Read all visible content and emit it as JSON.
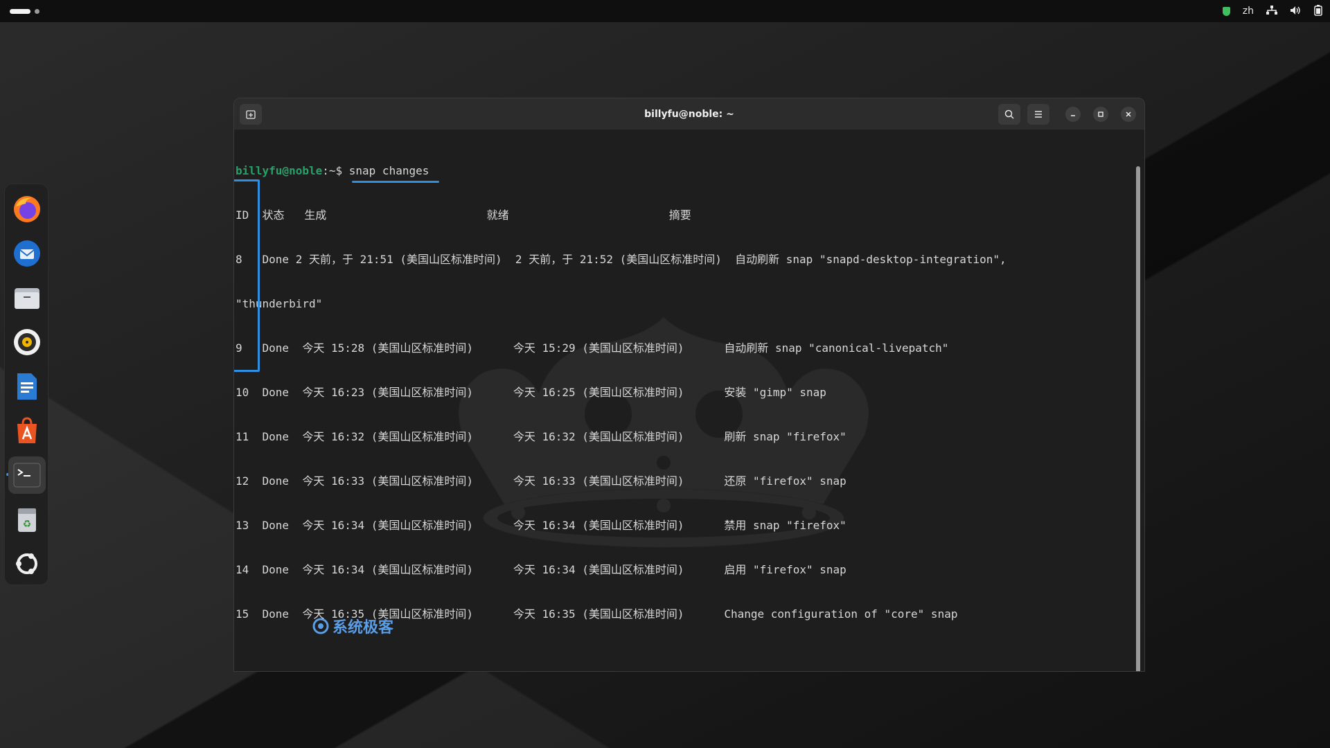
{
  "topbar": {
    "input_method": "zh",
    "icons": [
      "security-shield-icon",
      "network-icon",
      "volume-icon",
      "battery-icon"
    ]
  },
  "dock": {
    "items": [
      {
        "name": "firefox",
        "icon": "firefox-icon"
      },
      {
        "name": "thunderbird",
        "icon": "thunderbird-icon"
      },
      {
        "name": "files",
        "icon": "files-icon"
      },
      {
        "name": "rhythmbox",
        "icon": "rhythmbox-icon"
      },
      {
        "name": "libreoffice-writer",
        "icon": "writer-icon"
      },
      {
        "name": "app-center",
        "icon": "app-center-icon"
      },
      {
        "name": "terminal",
        "icon": "terminal-icon",
        "active": true
      },
      {
        "name": "trash",
        "icon": "trash-icon"
      },
      {
        "name": "show-apps",
        "icon": "ubuntu-icon"
      }
    ]
  },
  "window": {
    "title": "billyfu@noble: ~"
  },
  "terminal": {
    "prompt_user": "billyfu@noble",
    "prompt_rest": ":~$ ",
    "command": "snap changes",
    "header": "ID  状态   生成                        就绪                        摘要",
    "rows": [
      "8   Done 2 天前，于 21:51 (美国山区标准时间)  2 天前，于 21:52 (美国山区标准时间)  自动刷新 snap \"snapd-desktop-integration\",",
      "\"thunderbird\"",
      "9   Done  今天 15:28 (美国山区标准时间)      今天 15:29 (美国山区标准时间)      自动刷新 snap \"canonical-livepatch\"",
      "10  Done  今天 16:23 (美国山区标准时间)      今天 16:25 (美国山区标准时间)      安装 \"gimp\" snap",
      "11  Done  今天 16:32 (美国山区标准时间)      今天 16:32 (美国山区标准时间)      刷新 snap \"firefox\"",
      "12  Done  今天 16:33 (美国山区标准时间)      今天 16:33 (美国山区标准时间)      还原 \"firefox\" snap",
      "13  Done  今天 16:34 (美国山区标准时间)      今天 16:34 (美国山区标准时间)      禁用 snap \"firefox\"",
      "14  Done  今天 16:34 (美国山区标准时间)      今天 16:34 (美国山区标准时间)      启用 \"firefox\" snap",
      "15  Done  今天 16:35 (美国山区标准时间)      今天 16:35 (美国山区标准时间)      Change configuration of \"core\" snap"
    ],
    "blank": " ",
    "prompt2_rest": ":~$ "
  },
  "watermark": {
    "text": "系统极客"
  },
  "colors": {
    "prompt_green": "#26a269",
    "highlight_blue": "#2f8fe0"
  }
}
